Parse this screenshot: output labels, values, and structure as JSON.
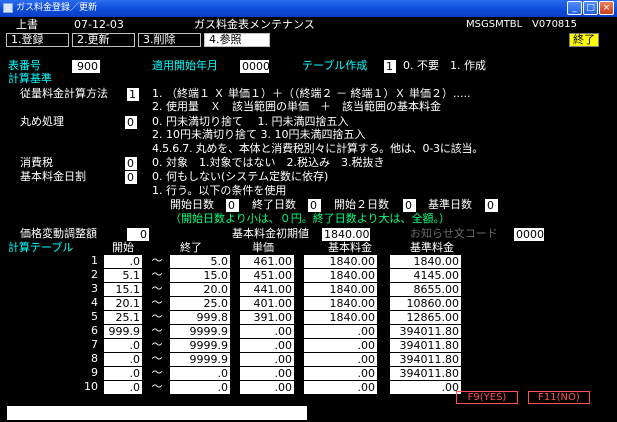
{
  "window": {
    "title": "ガス料金登録／更新",
    "minimize": "_",
    "maximize": "□",
    "close": "×"
  },
  "header": {
    "user": "上書",
    "date": "07-12-03",
    "title": "ガス料金表メンテナンス",
    "program": "MSGSMTBL",
    "version": "V070815"
  },
  "menu": [
    {
      "label": "1.登録"
    },
    {
      "label": "2.更新"
    },
    {
      "label": "3.削除"
    },
    {
      "label": "4.参照"
    }
  ],
  "end_button": "終了",
  "form": {
    "table_no_label": "表番号",
    "table_no": "900",
    "start_ym_label": "適用開始年月",
    "start_ym": "0000",
    "create_label": "テーブル作成",
    "create_value": "1",
    "create_opts": "0. 不要　1. 作成",
    "calc_basis_label": "計算基準",
    "usage_method_label": "従量料金計算方法",
    "usage_method": "1",
    "usage_opt1": "1. （終端１ Ｘ 単価１）＋（（終端２ － 終端１）Ｘ 単価２）.....",
    "usage_opt2": "2. 使用量　Ｘ　該当範囲の単価　＋　該当範囲の基本料金",
    "rounding_label": "丸め処理",
    "rounding": "0",
    "rounding_opt1": "0. 円未満切り捨て　 1. 円未満四捨五入",
    "rounding_opt2": "2. 10円未満切り捨て 3. 10円未満四捨五入",
    "rounding_opt3": "4.5.6.7. 丸めを、本体と消費税別々に計算する。他は、0-3に該当。",
    "tax_label": "消費税",
    "tax": "0",
    "tax_opts": "0. 対象　1.対象ではない　2.税込み　3.税抜き",
    "daily_label": "基本料金日割",
    "daily": "0",
    "daily_opt1": "0. 何もしない(システム定数に依存)",
    "daily_opt2": "1. 行う。以下の条件を使用",
    "start_days_label": "開始日数",
    "start_days": "0",
    "end_days_label": "終了日数",
    "end_days": "0",
    "start_days2_label": "開始２日数",
    "start_days2": "0",
    "base_days_label": "基準日数",
    "base_days": "0",
    "days_note": "（開始日数より小は、０円。終了日数より大は、全額。）",
    "price_adj_label": "価格変動調整額",
    "price_adj": "0",
    "base_initial_label": "基本料金初期値",
    "base_initial": "1840.00",
    "notice_label": "お知らせ文コード",
    "notice": "0000"
  },
  "calc_table": {
    "label": "計算テーブル",
    "headers": {
      "start": "開始",
      "end": "終了",
      "unit": "単価",
      "base": "基本料金",
      "std": "基準料金"
    },
    "tilde": "～",
    "rows": [
      {
        "no": "1",
        "start": ".0",
        "end": "5.0",
        "unit": "461.00",
        "base": "1840.00",
        "std": "1840.00"
      },
      {
        "no": "2",
        "start": "5.1",
        "end": "15.0",
        "unit": "451.00",
        "base": "1840.00",
        "std": "4145.00"
      },
      {
        "no": "3",
        "start": "15.1",
        "end": "20.0",
        "unit": "441.00",
        "base": "1840.00",
        "std": "8655.00"
      },
      {
        "no": "4",
        "start": "20.1",
        "end": "25.0",
        "unit": "401.00",
        "base": "1840.00",
        "std": "10860.00"
      },
      {
        "no": "5",
        "start": "25.1",
        "end": "999.8",
        "unit": "391.00",
        "base": "1840.00",
        "std": "12865.00"
      },
      {
        "no": "6",
        "start": "999.9",
        "end": "9999.9",
        "unit": ".00",
        "base": ".00",
        "std": "394011.80"
      },
      {
        "no": "7",
        "start": ".0",
        "end": "9999.9",
        "unit": ".00",
        "base": ".00",
        "std": "394011.80"
      },
      {
        "no": "8",
        "start": ".0",
        "end": "9999.9",
        "unit": ".00",
        "base": ".00",
        "std": "394011.80"
      },
      {
        "no": "9",
        "start": ".0",
        "end": ".0",
        "unit": ".00",
        "base": ".00",
        "std": "394011.80"
      },
      {
        "no": "10",
        "start": ".0",
        "end": ".0",
        "unit": ".00",
        "base": ".00",
        "std": ".00"
      }
    ]
  },
  "fkeys": {
    "f9": "F9(YES)",
    "f11": "F11(NO)"
  },
  "colors": {
    "titlebar": "#0c4ad8",
    "label_cyan": "#00ffff",
    "note_green": "#00ff7f",
    "fkey_red": "#ff5050",
    "end_yellow": "#ffff00"
  }
}
